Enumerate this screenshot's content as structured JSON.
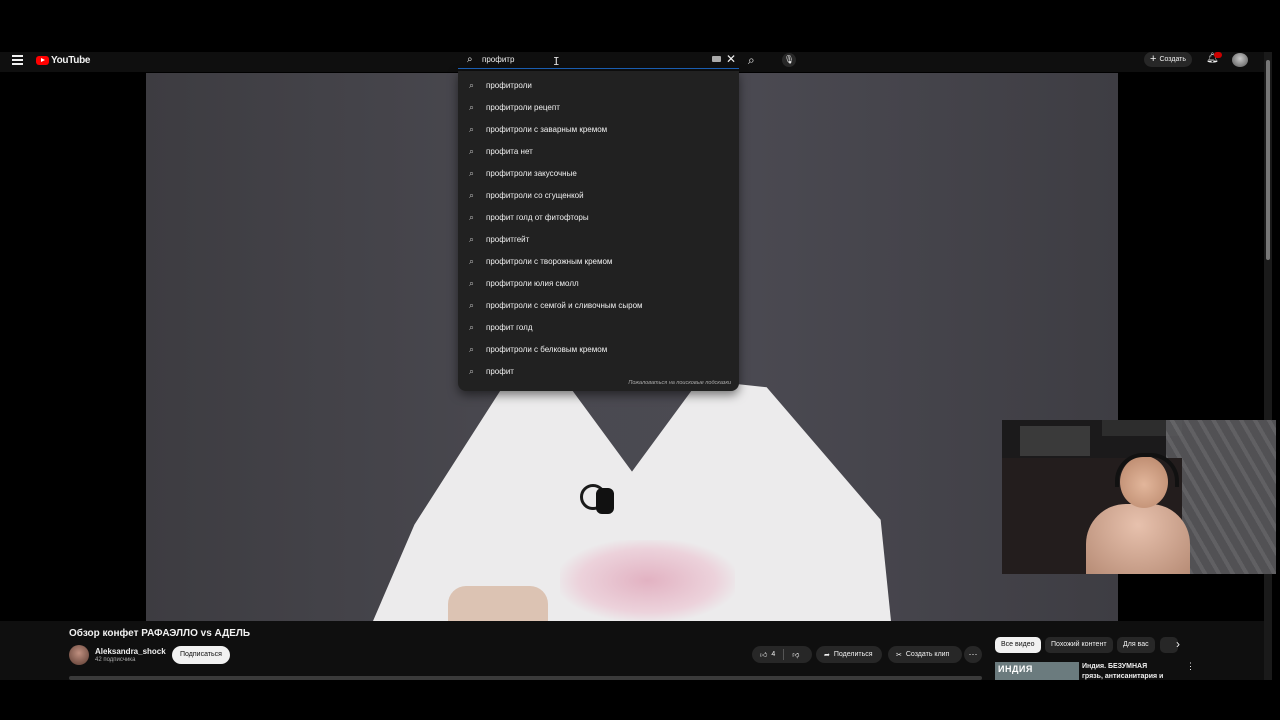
{
  "header": {
    "logo_text": "YouTube",
    "search_value": "профитр",
    "create_label": "Создать"
  },
  "suggestions": {
    "items": [
      "профитроли",
      "профитроли рецепт",
      "профитроли с заварным кремом",
      "профита нет",
      "профитроли закусочные",
      "профитроли со сгущенкой",
      "профит голд от фитофторы",
      "профитгейт",
      "профитроли с творожным кремом",
      "профитроли юлия смолл",
      "профитроли с семгой и сливочным сыром",
      "профит голд",
      "профитроли с белковым кремом",
      "профит"
    ],
    "report_label": "Пожаловаться на поисковые подсказки"
  },
  "video": {
    "title": "Обзор конфет РАФАЭЛЛО vs АДЕЛЬ",
    "channel": "Aleksandra_shock",
    "subscribers": "42 подписчика",
    "subscribe_label": "Подписаться",
    "like_count": "4",
    "share_label": "Поделиться",
    "clip_label": "Создать клип"
  },
  "sidebar": {
    "chips": [
      "Все видео",
      "Похожий контент",
      "Для вас"
    ],
    "recommendation": {
      "thumb_text": "ИНДИЯ",
      "title": "Индия. БЕЗУМНАЯ грязь, антисанитария и хаос. На"
    }
  },
  "icons": {
    "search": "search-icon",
    "mic": "mic-icon",
    "clear": "close-icon",
    "bell": "bell-icon"
  },
  "colors": {
    "background": "#0f0f0f",
    "dropdown": "#212121",
    "brand_red": "#ff0000",
    "focus_blue": "#1c62b9"
  }
}
